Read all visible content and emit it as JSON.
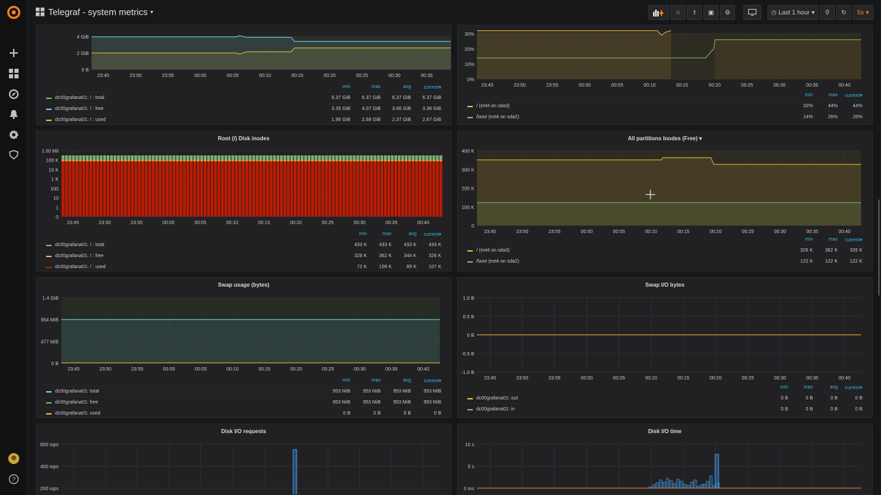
{
  "topbar": {
    "dashboard_title": "Telegraf - system metrics",
    "time_range": "Last 1 hour",
    "refresh": "5s"
  },
  "sidebar": {
    "icons": [
      "grafana-logo-icon",
      "plus-icon",
      "dashboards-icon",
      "explore-icon",
      "alerting-icon",
      "configuration-icon",
      "shield-icon",
      "user-avatar-icon",
      "help-icon"
    ]
  },
  "time_ticks": [
    "23:45",
    "23:50",
    "23:55",
    "00:00",
    "00:05",
    "00:10",
    "00:15",
    "00:20",
    "00:25",
    "00:30",
    "00:35",
    "00:40"
  ],
  "colors": {
    "green": "#7eb26d",
    "yellow": "#eab839",
    "blue": "#6ed0e0",
    "orange": "#ef843c",
    "red": "#e24d42",
    "bar_blue": "#1f78c1",
    "legend_header": "#33b5e5"
  },
  "panels": {
    "disk_usage": {
      "y_ticks": [
        "4 GiB",
        "2 GiB",
        "0 B"
      ],
      "legend_headers": [
        "min",
        "max",
        "avg",
        "current"
      ],
      "rows": [
        {
          "name": "dc00grafana01: / : total",
          "values": [
            "6.37 GiB",
            "6.37 GiB",
            "6.37 GiB",
            "6.37 GiB"
          ]
        },
        {
          "name": "dc00grafana01: / : free",
          "values": [
            "3.35 GiB",
            "4.07 GiB",
            "3.66 GiB",
            "3.36 GiB"
          ]
        },
        {
          "name": "dc00grafana01: / : used",
          "values": [
            "1.96 GiB",
            "2.68 GiB",
            "2.37 GiB",
            "2.67 GiB"
          ]
        }
      ]
    },
    "disk_pct": {
      "y_ticks": [
        "30%",
        "20%",
        "10%",
        "0%"
      ],
      "legend_headers": [
        "min",
        "max",
        "current"
      ],
      "rows": [
        {
          "name": "/ (ext4 on sda3)",
          "values": [
            "32%",
            "44%",
            "44%"
          ]
        },
        {
          "name": "/boot (ext4 on sda2)",
          "values": [
            "14%",
            "26%",
            "26%"
          ]
        }
      ]
    },
    "root_inodes": {
      "title": "Root (/) Disk inodes",
      "y_ticks": [
        "1.00 Mil",
        "100 K",
        "10 K",
        "1 K",
        "100",
        "10",
        "1",
        "0"
      ],
      "legend_headers": [
        "min",
        "max",
        "avg",
        "current"
      ],
      "rows": [
        {
          "name": "dc00grafana01: / : total",
          "values": [
            "433 K",
            "433 K",
            "433 K",
            "433 K"
          ]
        },
        {
          "name": "dc00grafana01: / : free",
          "values": [
            "326 K",
            "362 K",
            "344 K",
            "326 K"
          ]
        },
        {
          "name": "dc00grafana01: / : used",
          "values": [
            "72 K",
            "108 K",
            "89 K",
            "107 K"
          ]
        }
      ]
    },
    "all_inodes": {
      "title": "All partitions Inodes (Free)",
      "y_ticks": [
        "400 K",
        "300 K",
        "200 K",
        "100 K",
        "0"
      ],
      "legend_headers": [
        "min",
        "max",
        "current"
      ],
      "rows": [
        {
          "name": "/ (ext4 on sda3)",
          "values": [
            "326 K",
            "362 K",
            "326 K"
          ]
        },
        {
          "name": "/boot (ext4 on sda2)",
          "values": [
            "122 K",
            "122 K",
            "122 K"
          ]
        }
      ]
    },
    "swap_usage": {
      "title": "Swap usage (bytes)",
      "y_ticks": [
        "1.4 GiB",
        "954 MiB",
        "477 MiB",
        "0 B"
      ],
      "legend_headers": [
        "min",
        "max",
        "avg",
        "current"
      ],
      "rows": [
        {
          "name": "dc00grafana01: total",
          "values": [
            "953 MiB",
            "953 MiB",
            "953 MiB",
            "953 MiB"
          ]
        },
        {
          "name": "dc00grafana01: free",
          "values": [
            "953 MiB",
            "953 MiB",
            "953 MiB",
            "953 MiB"
          ]
        },
        {
          "name": "dc00grafana01: used",
          "values": [
            "0 B",
            "0 B",
            "0 B",
            "0 B"
          ]
        }
      ]
    },
    "swap_io": {
      "title": "Swap I/O bytes",
      "y_ticks": [
        "1.0 B",
        "0.5 B",
        "0 B",
        "-0.5 B",
        "-1.0 B"
      ],
      "legend_headers": [
        "min",
        "max",
        "avg",
        "current"
      ],
      "rows": [
        {
          "name": "dc00grafana01: out",
          "values": [
            "0 B",
            "0 B",
            "0 B",
            "0 B"
          ]
        },
        {
          "name": "dc00grafana01: in",
          "values": [
            "0 B",
            "0 B",
            "0 B",
            "0 B"
          ]
        }
      ]
    },
    "disk_io_requests": {
      "title": "Disk I/O requests",
      "y_ticks": [
        "600 iops",
        "400 iops",
        "200 iops"
      ]
    },
    "disk_io_time": {
      "title": "Disk I/O time",
      "y_ticks": [
        "10 s",
        "5 s",
        "0 ms"
      ]
    }
  },
  "chart_data": [
    {
      "type": "line",
      "series": [
        {
          "name": "dc00grafana01: / : total",
          "values": [
            6.37,
            6.37
          ]
        },
        {
          "name": "dc00grafana01: / : free",
          "values": [
            4.07,
            4.0,
            3.95,
            3.36,
            3.36
          ]
        },
        {
          "name": "dc00grafana01: / : used",
          "values": [
            1.96,
            2.0,
            2.1,
            2.67,
            2.67
          ]
        }
      ],
      "ylim": [
        0,
        4.5
      ]
    },
    {
      "type": "line",
      "series": [
        {
          "name": "/ (ext4 on sda3)",
          "values": [
            32,
            32,
            44,
            44
          ]
        },
        {
          "name": "/boot (ext4 on sda2)",
          "values": [
            14,
            14,
            26,
            26
          ]
        }
      ],
      "ylim": [
        0,
        35
      ]
    },
    {
      "type": "bar",
      "series": [
        {
          "name": "dc00grafana01: / : total",
          "values": [
            433000
          ]
        },
        {
          "name": "dc00grafana01: / : used",
          "values": [
            89000
          ]
        }
      ]
    },
    {
      "type": "line",
      "series": [
        {
          "name": "/ (ext4 on sda3)",
          "values": [
            350,
            350,
            362,
            362,
            326,
            326
          ]
        },
        {
          "name": "/boot (ext4 on sda2)",
          "values": [
            122,
            122
          ]
        }
      ],
      "ylim": [
        0,
        400
      ]
    },
    {
      "type": "line",
      "series": [
        {
          "name": "dc00grafana01: total",
          "values": [
            953,
            953
          ]
        },
        {
          "name": "dc00grafana01: used",
          "values": [
            0,
            0
          ]
        }
      ],
      "ylim": [
        0,
        1430
      ]
    },
    {
      "type": "line",
      "series": [
        {
          "name": "dc00grafana01: out",
          "values": [
            0,
            0
          ]
        }
      ],
      "ylim": [
        -1,
        1
      ]
    }
  ]
}
